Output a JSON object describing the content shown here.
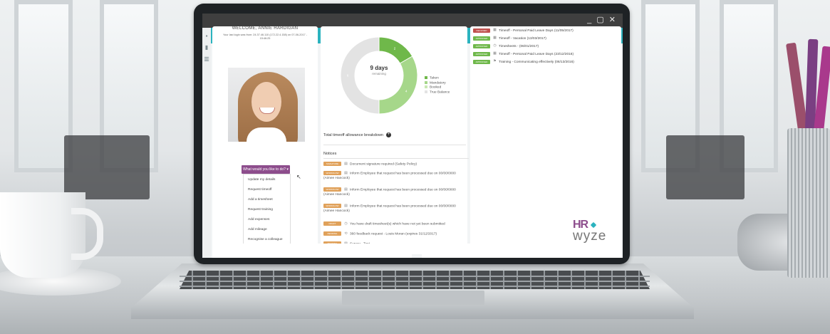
{
  "window": {
    "controls": "_ ▢ ✕"
  },
  "profile": {
    "welcome": "WELCOME, ANNIE HARDIGAN",
    "last_login": "Your last login was from: 24.37.46.110 (172.22.4.158) on 07-06-2017 - 15:46:25",
    "action_button": "What would you like to do? ▾",
    "menu": [
      "Update my details",
      "Request timeoff",
      "Add a timesheet",
      "Request training",
      "Add expenses",
      "Add mileage",
      "Recognise a colleague"
    ]
  },
  "allowance": {
    "days_value": "9 days",
    "days_label": "remaining",
    "legend": [
      {
        "label": "Taken",
        "color": "#6fb84a"
      },
      {
        "label": "Mandatory",
        "color": "#a6d78a"
      },
      {
        "label": "Booked",
        "color": "#c9e7b3"
      },
      {
        "label": "True Balance",
        "color": "#e3e3e3"
      }
    ],
    "segment_labels": [
      "2",
      "4",
      "6"
    ],
    "breakdown_label": "Total timeoff allowance breakdown",
    "plus_icon": "+"
  },
  "chart_data": {
    "type": "pie",
    "categories": [
      "Taken",
      "Mandatory",
      "Booked",
      "True Balance"
    ],
    "values": [
      2,
      4,
      0,
      6
    ],
    "center_text": "9 days remaining"
  },
  "notices": {
    "title": "Notices",
    "items": [
      {
        "tag": "SIGNATURE",
        "tag_color": "#e0a15a",
        "icon": "doc-icon",
        "text": "Document signature required (Safety Policy)"
      },
      {
        "tag": "WORKFLOW",
        "tag_color": "#e0a15a",
        "icon": "doc-icon",
        "text": "Inform Employee that request has been processed due on 00/00/0000 (Aimee Hancock)"
      },
      {
        "tag": "WORKFLOW",
        "tag_color": "#e0a15a",
        "icon": "doc-icon",
        "text": "Inform Employee that request has been processed due on 00/00/0000 (Aimee Hancock)"
      },
      {
        "tag": "WORKFLOW",
        "tag_color": "#e0a15a",
        "icon": "doc-icon",
        "text": "Inform Employee that request has been processed due on 00/00/0000 (Aimee Hancock)"
      },
      {
        "tag": "DRAFT",
        "tag_color": "#e0a15a",
        "icon": "clock-icon",
        "text": "You have draft timesheet(s) which have not yet been submitted"
      },
      {
        "tag": "PENDING",
        "tag_color": "#e0a15a",
        "icon": "refresh-icon",
        "text": "360 feedback request - Louis Moran (expires 31/12/2017)"
      },
      {
        "tag": "PENDING",
        "tag_color": "#e0a15a",
        "icon": "doc-icon",
        "text": "Survey - Test"
      }
    ]
  },
  "requests": [
    {
      "status": "DECLINED",
      "color": "#c0504d",
      "icon": "calendar-icon",
      "text": "Timeoff - Personal Paid Leave Days (11/05/2017)"
    },
    {
      "status": "APPROVED",
      "color": "#6fb84a",
      "icon": "calendar-icon",
      "text": "Timeoff - Vacation (13/03/2017)"
    },
    {
      "status": "APPROVED",
      "color": "#6fb84a",
      "icon": "clock-icon",
      "text": "Timesheets - (06/01/2017)"
    },
    {
      "status": "APPROVED",
      "color": "#6fb84a",
      "icon": "calendar-icon",
      "text": "Timeoff - Personal Paid Leave Days (23/12/2016)"
    },
    {
      "status": "APPROVED",
      "color": "#6fb84a",
      "icon": "training-icon",
      "text": "Training - Communicating effectively (06/13/2016)"
    }
  ],
  "logo": {
    "hr": "HR",
    "wyze": "wyze"
  },
  "colors": {
    "teal": "#2bb3bf",
    "purple": "#8d4d8c",
    "tag_orange": "#e0a15a"
  }
}
